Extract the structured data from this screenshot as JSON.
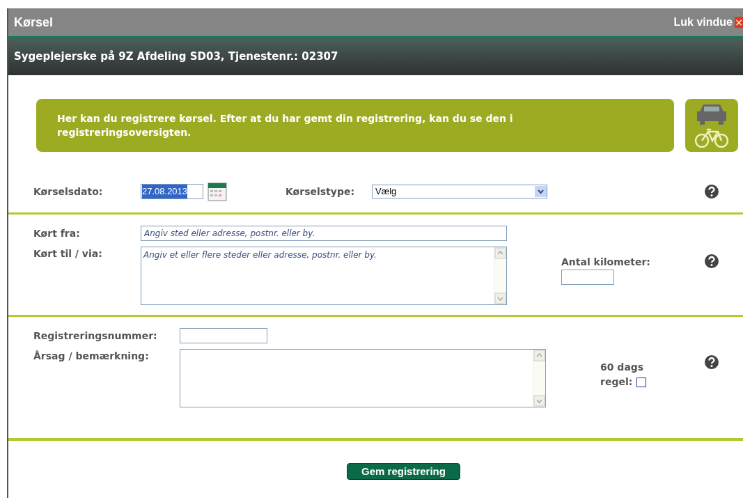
{
  "window": {
    "title": "Kørsel",
    "close_label": "Luk vindue",
    "close_glyph": "×"
  },
  "header": "Sygeplejerske på 9Z Afdeling SD03, Tjenestenr.: 02307",
  "info": "Her kan du registrere kørsel. Efter at du har gemt din registrering, kan du se den i registreringsoversigten.",
  "date": {
    "label": "Kørselsdato:",
    "value": "27.08.2013",
    "selected": true
  },
  "type": {
    "label": "Kørselstype:",
    "value": "Vælg"
  },
  "from": {
    "label": "Kørt fra:",
    "placeholder": "Angiv sted eller adresse, postnr. eller by."
  },
  "to": {
    "label": "Kørt til / via:",
    "placeholder": "Angiv et eller flere steder eller adresse, postnr. eller by."
  },
  "km": {
    "label": "Antal kilometer:"
  },
  "regnr": {
    "label": "Registreringsnummer:"
  },
  "remark": {
    "label": "Årsag / bemærkning:"
  },
  "rule60": {
    "label_1": "60 dags",
    "label_2": "regel:",
    "checked": false
  },
  "save": "Gem registrering"
}
